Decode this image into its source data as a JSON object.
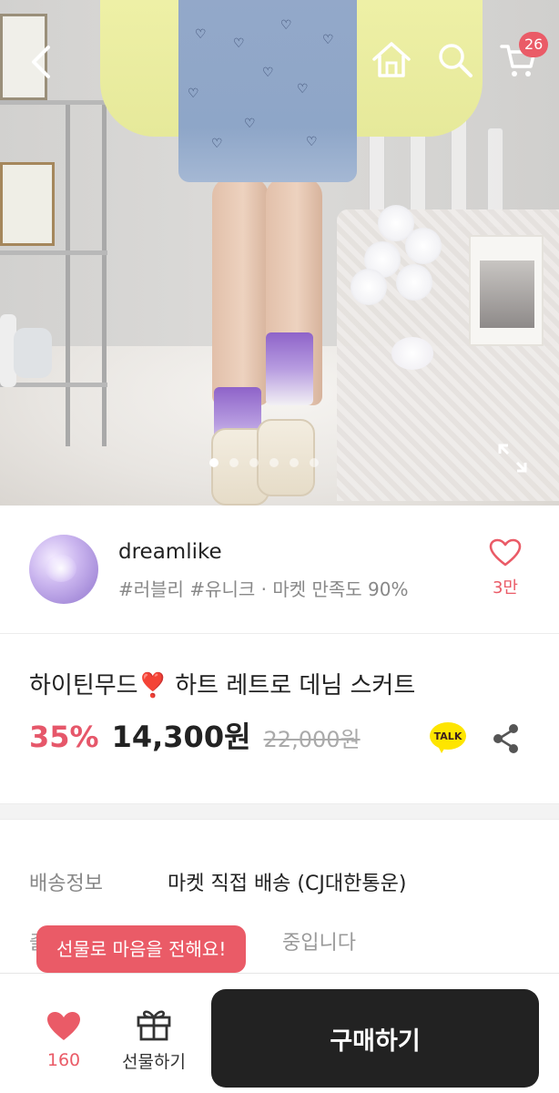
{
  "header": {
    "cart_count": "26"
  },
  "shop": {
    "name": "dreamlike",
    "tags": "#러블리 #유니크 · 마켓 만족도 90%",
    "like_count": "3만"
  },
  "product": {
    "title_prefix": "하이틴무드",
    "title_emoji": "❣️",
    "title_suffix": "하트 레트로 데님 스커트",
    "discount": "35%",
    "price": "14,300원",
    "original_price": "22,000원",
    "talk_label": "TALK"
  },
  "shipping": {
    "label": "배송정보",
    "value": "마켓 직접 배송 (CJ대한통운)",
    "row2_lead": "출",
    "row2_tail": "중입니다"
  },
  "tooltip": {
    "text": "선물로 마음을 전해요!"
  },
  "bottom_bar": {
    "wish_count": "160",
    "gift_label": "선물하기",
    "buy_label": "구매하기"
  },
  "colors": {
    "accent": "#ea5b67",
    "buy_button": "#222222",
    "kakao_yellow": "#fee500"
  },
  "icons": [
    "back-arrow-icon",
    "home-icon",
    "search-icon",
    "cart-icon",
    "expand-icon",
    "heart-outline-icon",
    "kakao-talk-icon",
    "share-icon",
    "heart-filled-icon",
    "gift-icon"
  ]
}
